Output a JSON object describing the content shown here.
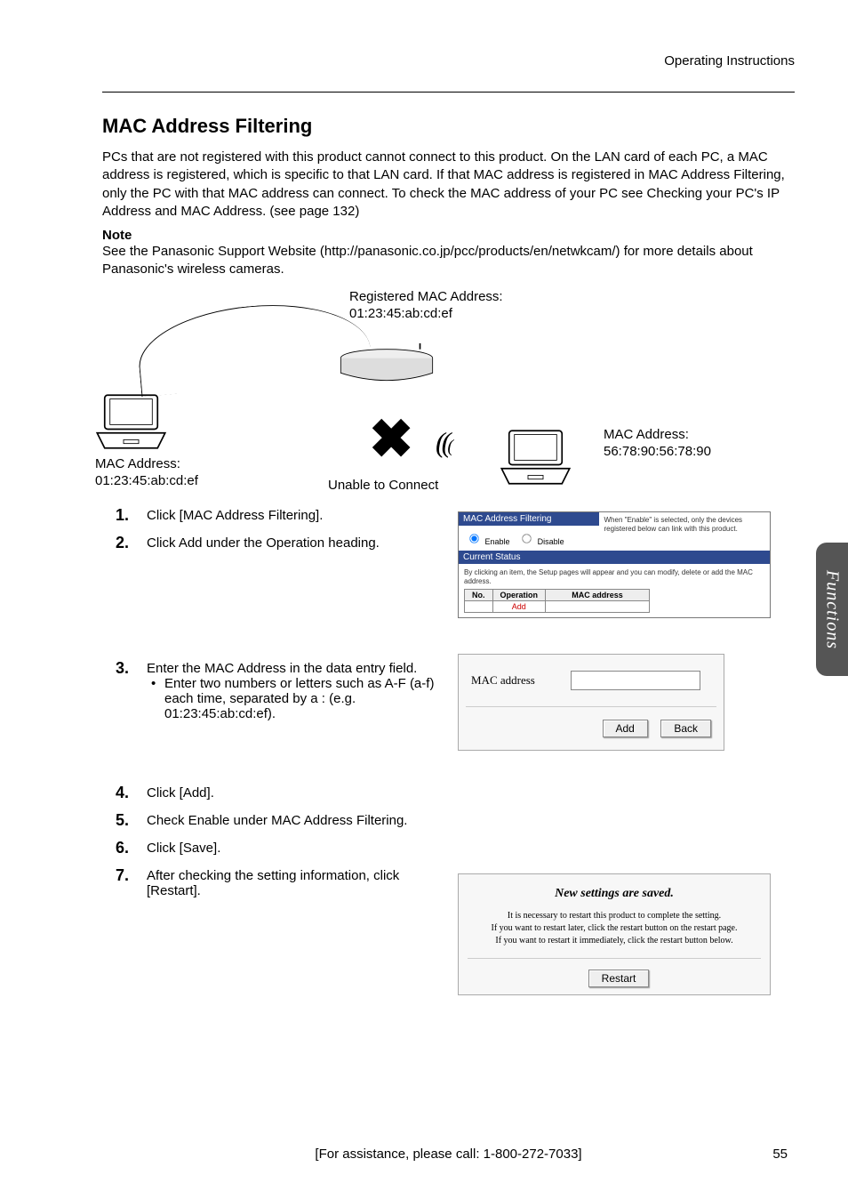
{
  "header": {
    "running": "Operating Instructions"
  },
  "title": "MAC Address Filtering",
  "intro": "PCs that are not registered with this product cannot connect to this product. On the LAN card of each PC, a MAC address is registered, which is specific to that LAN card. If that MAC address is registered in MAC Address Filtering, only the PC with that MAC address can connect. To check the MAC address of your PC see Checking your PC's IP Address and MAC Address. (see page 132)",
  "note_label": "Note",
  "note_text": "See the Panasonic Support Website (http://panasonic.co.jp/pcc/products/en/netwkcam/) for more details about Panasonic's wireless cameras.",
  "diagram": {
    "registered_label": "Registered MAC Address:",
    "registered_value": "01:23:45:ab:cd:ef",
    "left_label": "MAC Address:",
    "left_value": "01:23:45:ab:cd:ef",
    "unable": "Unable to Connect",
    "right_label": "MAC Address:",
    "right_value": "56:78:90:56:78:90"
  },
  "steps": [
    {
      "n": "1.",
      "text": "Click [MAC Address Filtering]."
    },
    {
      "n": "2.",
      "text": "Click Add under the Operation heading."
    },
    {
      "n": "3.",
      "text": "Enter the MAC Address in the data entry field.",
      "sub": "Enter two numbers or letters such as A-F (a-f) each time, separated by a : (e.g. 01:23:45:ab:cd:ef)."
    },
    {
      "n": "4.",
      "text": "Click [Add]."
    },
    {
      "n": "5.",
      "text": "Check Enable under MAC Address Filtering."
    },
    {
      "n": "6.",
      "text": "Click [Save]."
    },
    {
      "n": "7.",
      "text": "After checking the setting information, click [Restart]."
    }
  ],
  "shot1": {
    "header": "MAC Address Filtering",
    "note": "When \"Enable\" is selected, only the devices registered below can link with this product.",
    "enable": "Enable",
    "disable": "Disable",
    "status_header": "Current Status",
    "status_text": "By clicking an item, the Setup pages will appear and you can modify, delete or add the MAC address.",
    "col_no": "No.",
    "col_op": "Operation",
    "col_mac": "MAC address",
    "add_link": "Add"
  },
  "shot2": {
    "label": "MAC address",
    "add": "Add",
    "back": "Back"
  },
  "shot3": {
    "title": "New settings are saved.",
    "line1": "It is necessary to restart this product to complete the setting.",
    "line2": "If you want to restart later, click the restart button on the restart page.",
    "line3": "If you want to restart it immediately, click the restart button below.",
    "restart": "Restart"
  },
  "sidebar": "Functions",
  "footer": {
    "assist": "[For assistance, please call: 1-800-272-7033]",
    "page": "55"
  }
}
